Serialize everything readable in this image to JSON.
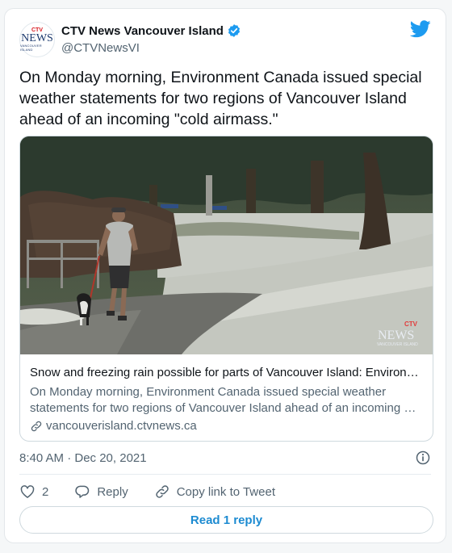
{
  "author": {
    "name": "CTV News Vancouver Island",
    "handle": "@CTVNewsVI",
    "avatar_logo": {
      "ctv": "CTV",
      "news": "NEWS",
      "region": "VANCOUVER ISLAND"
    }
  },
  "tweet": {
    "text": "On Monday morning, Environment Canada issued special weather statements for two regions of Vancouver Island ahead of an incoming \"cold airmass.\"",
    "timestamp": "8:40 AM · Dec 20, 2021"
  },
  "link_card": {
    "title": "Snow and freezing rain possible for parts of Vancouver Island: Environ…",
    "description_line1": "On Monday morning, Environment Canada issued special weather",
    "description_line2": "statements for two regions of Vancouver Island ahead of an incoming …",
    "domain": "vancouverisland.ctvnews.ca",
    "image_watermark": {
      "ctv": "CTV",
      "news": "NEWS",
      "region": "VANCOUVER ISLAND"
    }
  },
  "actions": {
    "like_count": "2",
    "reply_label": "Reply",
    "copy_label": "Copy link to Tweet"
  },
  "read_reply_label": "Read 1 reply",
  "icons": [
    "verified-badge-icon",
    "twitter-bird-icon",
    "link-icon",
    "info-icon",
    "heart-icon",
    "reply-icon",
    "copy-link-icon"
  ],
  "colors": {
    "twitter_blue": "#1d9bf0",
    "secondary_text": "#536471",
    "border": "#cfd9de"
  }
}
